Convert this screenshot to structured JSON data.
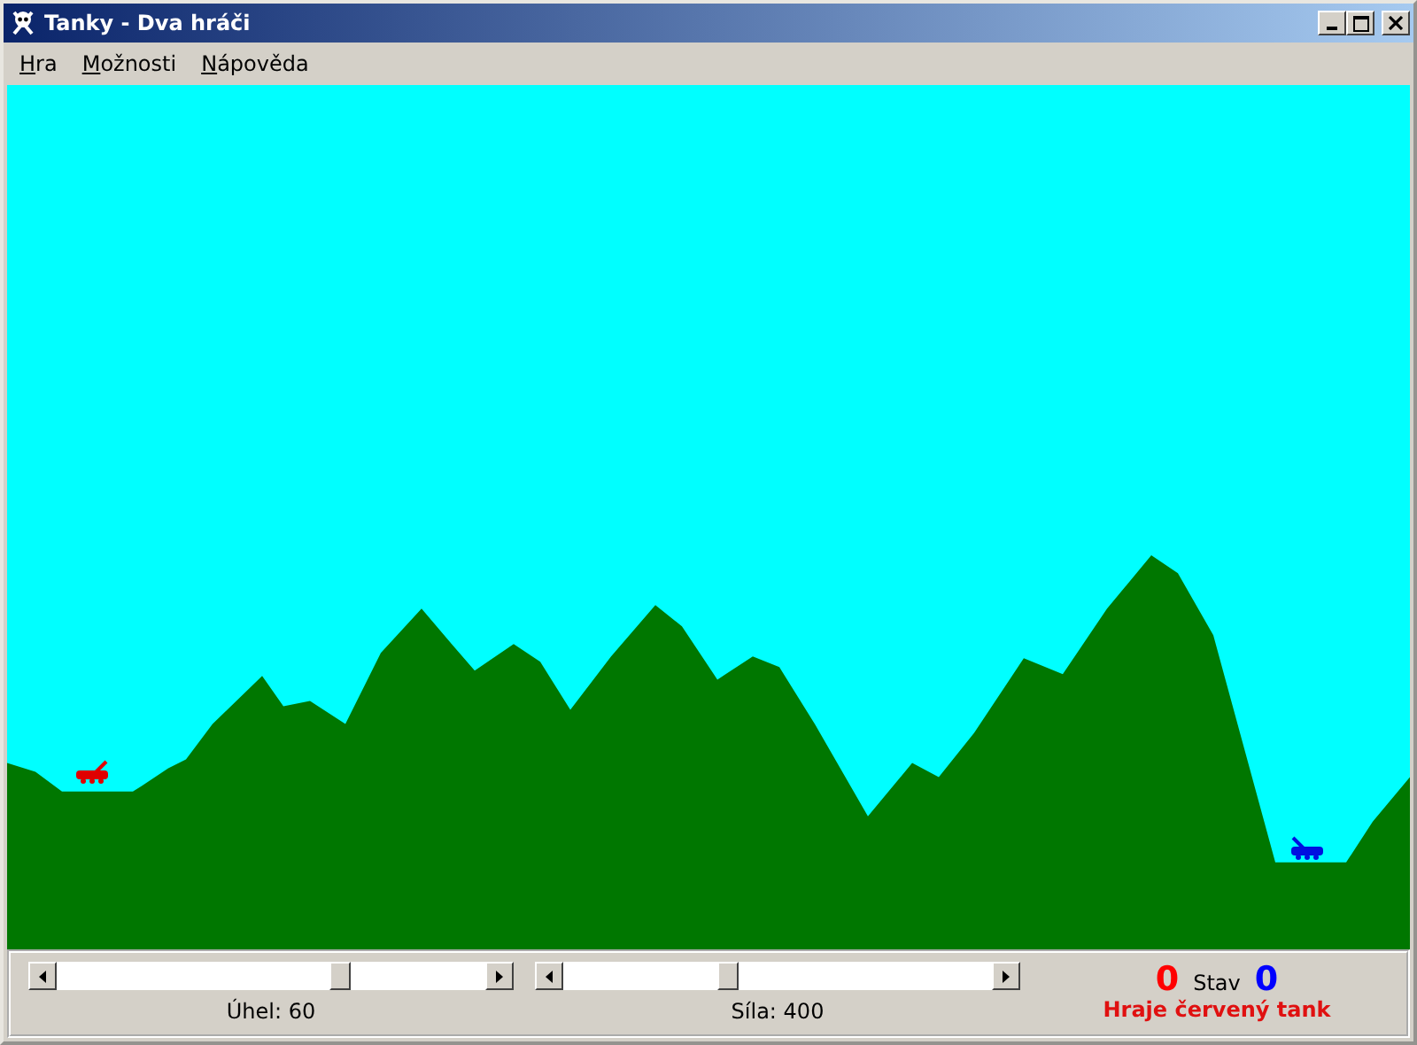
{
  "window": {
    "title": "Tanky - Dva hráči"
  },
  "menu": [
    {
      "label": "Hra"
    },
    {
      "label": "Možnosti"
    },
    {
      "label": "Nápověda"
    }
  ],
  "tanks": [
    {
      "color": "#e00000"
    },
    {
      "color": "#0010e0"
    }
  ],
  "controls": [
    {
      "level": 0.67,
      "label": "Úhel: 60"
    },
    {
      "level": 0.38,
      "label": "Síla: 400"
    }
  ],
  "score": {
    "red": "0",
    "caption": "Stav",
    "blue": "0",
    "status": "Hraje červený tank"
  }
}
